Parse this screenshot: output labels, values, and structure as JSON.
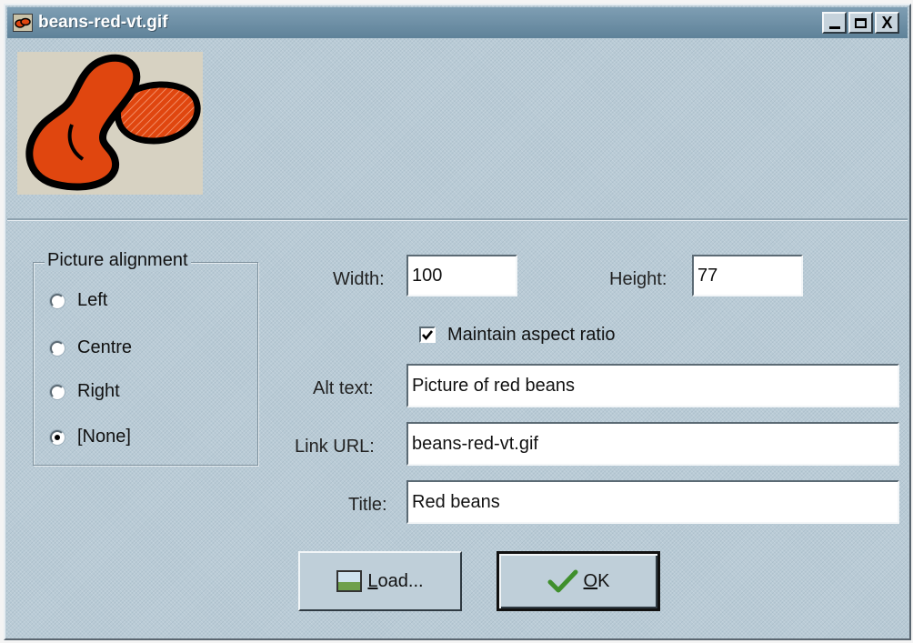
{
  "window": {
    "title": "beans-red-vt.gif",
    "controls": {
      "minimize": "_",
      "maximize": "□",
      "close": "X"
    }
  },
  "preview": {
    "alt": "red beans picture",
    "icon": "beans-image"
  },
  "alignment": {
    "legend": "Picture alignment",
    "options": [
      {
        "label": "Left",
        "checked": false
      },
      {
        "label": "Centre",
        "checked": false
      },
      {
        "label": "Right",
        "checked": false
      },
      {
        "label": "[None]",
        "checked": true
      }
    ]
  },
  "size": {
    "width_label": "Width:",
    "width_value": "100",
    "height_label": "Height:",
    "height_value": "77",
    "aspect_label": "Maintain aspect ratio",
    "aspect_checked": true
  },
  "fields": {
    "alt_label": "Alt text:",
    "alt_value": "Picture of red beans",
    "link_label": "Link URL:",
    "link_value": "beans-red-vt.gif",
    "title_label": "Title:",
    "title_value": "Red beans"
  },
  "buttons": {
    "load_label_underlined": "L",
    "load_label_rest": "oad...",
    "ok_label_underlined": "O",
    "ok_label_rest": "K"
  },
  "colors": {
    "background": "#b9cbd6",
    "titlebar": "#6f90a6",
    "bean_red": "#e0460f",
    "check_green": "#3f8f2c"
  }
}
